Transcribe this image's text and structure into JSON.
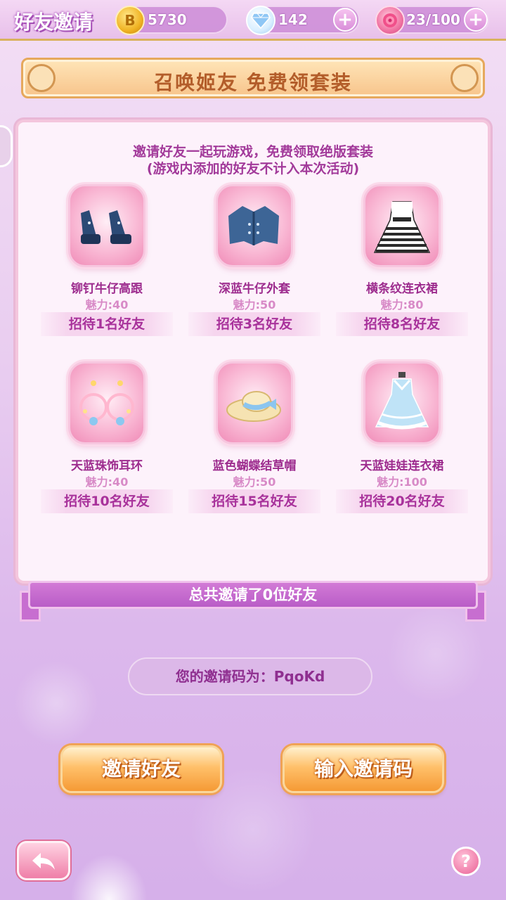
{
  "header": {
    "title": "好友邀请",
    "coins": "5730",
    "diamonds": "142",
    "roses": "23/100",
    "coin_symbol": "B",
    "plus_label": "+"
  },
  "banner": {
    "title": "召唤姬友 免费领套装"
  },
  "panel": {
    "intro_line1": "邀请好友一起玩游戏，免费领取绝版套装",
    "intro_line2": "(游戏内添加的好友不计入本次活动)",
    "items": [
      {
        "name": "铆钉牛仔高跟",
        "charm": "魅力:40",
        "requirement": "招待1名好友",
        "icon": "shoes-icon"
      },
      {
        "name": "深蓝牛仔外套",
        "charm": "魅力:50",
        "requirement": "招待3名好友",
        "icon": "jacket-icon"
      },
      {
        "name": "横条纹连衣裙",
        "charm": "魅力:80",
        "requirement": "招待8名好友",
        "icon": "striped-dress-icon"
      },
      {
        "name": "天蓝珠饰耳环",
        "charm": "魅力:40",
        "requirement": "招待10名好友",
        "icon": "earrings-icon"
      },
      {
        "name": "蓝色蝴蝶结草帽",
        "charm": "魅力:50",
        "requirement": "招待15名好友",
        "icon": "straw-hat-icon"
      },
      {
        "name": "天蓝娃娃连衣裙",
        "charm": "魅力:100",
        "requirement": "招待20名好友",
        "icon": "doll-dress-icon"
      }
    ]
  },
  "status": {
    "total_invited": "总共邀请了0位好友"
  },
  "invite_code": {
    "label": "您的邀请码为：PqoKd"
  },
  "buttons": {
    "invite": "邀请好友",
    "enter_code": "输入邀请码",
    "help": "?"
  }
}
